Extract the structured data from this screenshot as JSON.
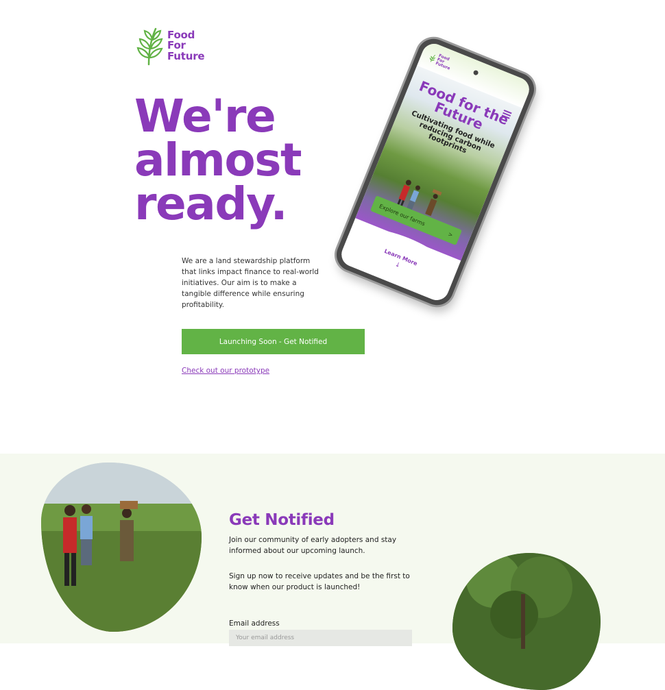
{
  "brand": {
    "logo_lines": [
      "Food",
      "For",
      "Future"
    ],
    "purple": "#8a3ab9",
    "green": "#62b346"
  },
  "hero": {
    "title_lines": [
      "We're",
      "almost",
      "ready."
    ],
    "intro": "We are a land stewardship platform that links impact finance to real-world initiatives. Our aim is to make a tangible difference while ensuring profitability.",
    "cta_label": "Launching Soon - Get Notified",
    "prototype_link": "Check out our prototype"
  },
  "phone": {
    "logo_lines": [
      "Food",
      "For",
      "Future"
    ],
    "title": "Food for the Future",
    "subtitle": "Cultivating food while reducing carbon footprints",
    "button_label": "Explore our farms",
    "button_arrow": ">",
    "learn_more": "Learn More",
    "down_arrow": "↓"
  },
  "notify": {
    "title": "Get Notified",
    "paragraph1": "Join our community of early adopters and stay informed about our upcoming launch.",
    "paragraph2": "Sign up now to receive updates and be the first to know when our product is launched!",
    "email_label": "Email address",
    "email_placeholder": "Your email address"
  }
}
